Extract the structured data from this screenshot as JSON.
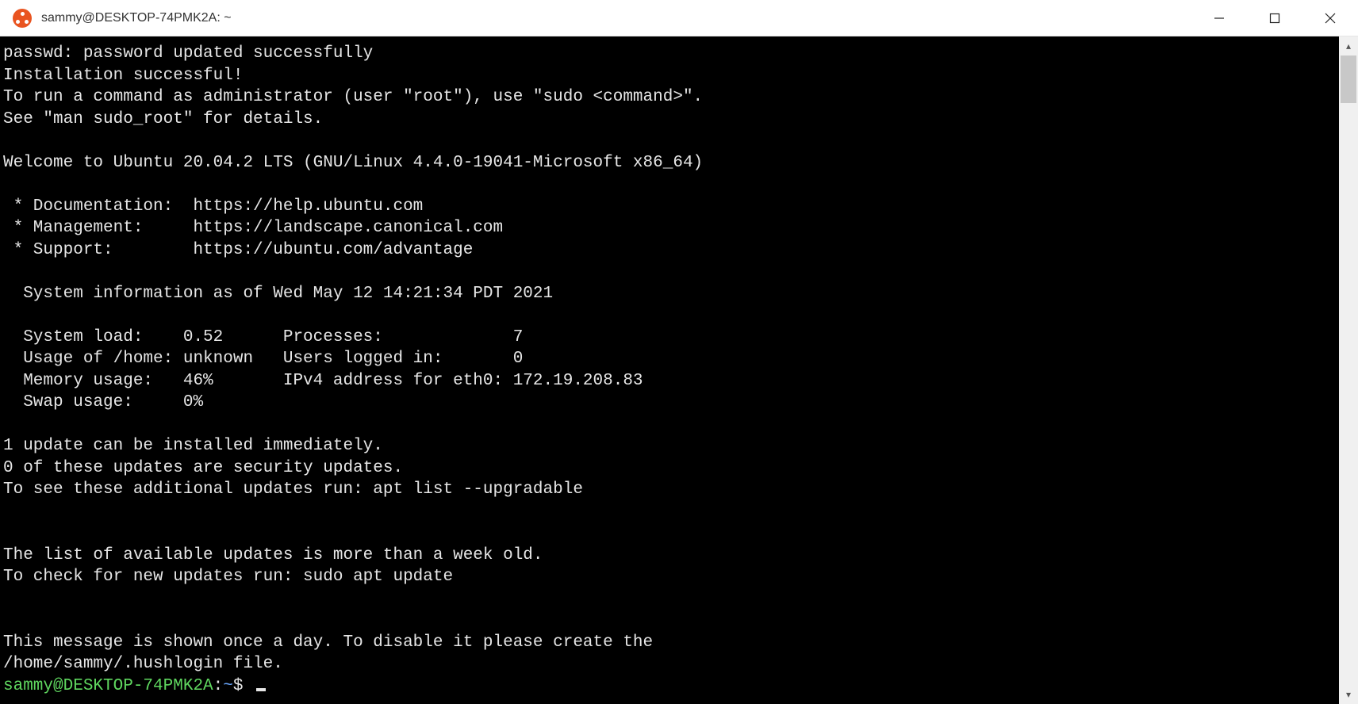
{
  "window": {
    "title": "sammy@DESKTOP-74PMK2A: ~"
  },
  "terminal": {
    "lines": [
      "passwd: password updated successfully",
      "Installation successful!",
      "To run a command as administrator (user \"root\"), use \"sudo <command>\".",
      "See \"man sudo_root\" for details.",
      "",
      "Welcome to Ubuntu 20.04.2 LTS (GNU/Linux 4.4.0-19041-Microsoft x86_64)",
      "",
      " * Documentation:  https://help.ubuntu.com",
      " * Management:     https://landscape.canonical.com",
      " * Support:        https://ubuntu.com/advantage",
      "",
      "  System information as of Wed May 12 14:21:34 PDT 2021",
      "",
      "  System load:    0.52      Processes:             7",
      "  Usage of /home: unknown   Users logged in:       0",
      "  Memory usage:   46%       IPv4 address for eth0: 172.19.208.83",
      "  Swap usage:     0%",
      "",
      "1 update can be installed immediately.",
      "0 of these updates are security updates.",
      "To see these additional updates run: apt list --upgradable",
      "",
      "",
      "The list of available updates is more than a week old.",
      "To check for new updates run: sudo apt update",
      "",
      "",
      "This message is shown once a day. To disable it please create the",
      "/home/sammy/.hushlogin file."
    ],
    "prompt": {
      "user_host": "sammy@DESKTOP-74PMK2A",
      "separator": ":",
      "path": "~",
      "symbol": "$"
    }
  },
  "colors": {
    "accent": "#e95420",
    "terminal_bg": "#000000",
    "terminal_fg": "#e6e6e6",
    "prompt_user": "#5fd75f",
    "prompt_path": "#6aa8ff"
  }
}
